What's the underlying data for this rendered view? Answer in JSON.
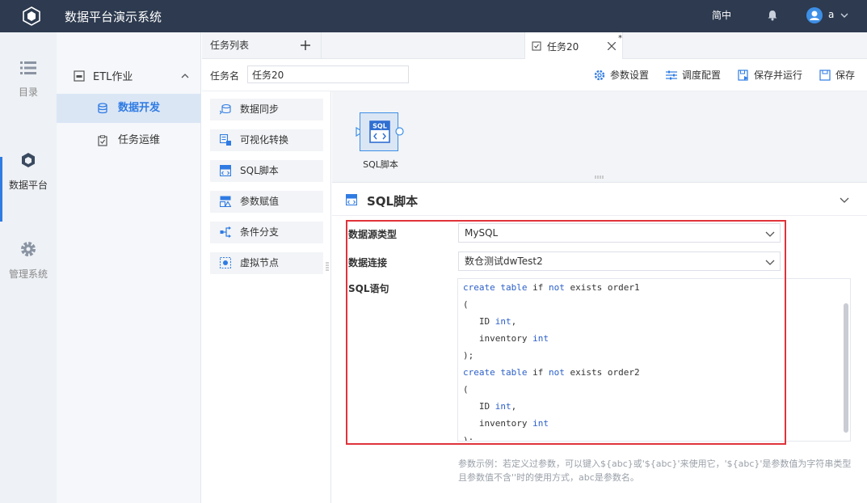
{
  "header": {
    "title": "数据平台演示系统",
    "language": "简中",
    "username": "a"
  },
  "rail": [
    {
      "label": "目录",
      "icon": "list-icon"
    },
    {
      "label": "数据平台",
      "icon": "cube-icon"
    },
    {
      "label": "管理系统",
      "icon": "gear-icon"
    }
  ],
  "nav": {
    "group": "ETL作业",
    "items": [
      {
        "label": "数据开发",
        "active": true
      },
      {
        "label": "任务运维",
        "active": false
      }
    ]
  },
  "tabs": {
    "list_label": "任务列表",
    "task_label": "任务20",
    "modified_mark": "*"
  },
  "toolbar": {
    "taskname_label": "任务名",
    "taskname_value": "任务20",
    "params": "参数设置",
    "schedule": "调度配置",
    "save_run": "保存并运行",
    "save": "保存"
  },
  "palette": [
    {
      "label": "数据同步",
      "icon": "sync-icon"
    },
    {
      "label": "可视化转换",
      "icon": "transform-icon"
    },
    {
      "label": "SQL脚本",
      "icon": "sql-icon"
    },
    {
      "label": "参数赋值",
      "icon": "param-assign-icon"
    },
    {
      "label": "条件分支",
      "icon": "branch-icon"
    },
    {
      "label": "虚拟节点",
      "icon": "virtual-node-icon"
    }
  ],
  "canvas": {
    "node_label": "SQL脚本",
    "node_badge": "SQL"
  },
  "panel": {
    "title": "SQL脚本",
    "datasource_type_label": "数据源类型",
    "datasource_type_value": "MySQL",
    "connection_label": "数据连接",
    "connection_value": "数仓测试dwTest2",
    "sql_label": "SQL语句",
    "sql_lines": [
      [
        {
          "t": "create table",
          "c": "kw"
        },
        {
          "t": " if ",
          "c": ""
        },
        {
          "t": "not",
          "c": "kw"
        },
        {
          "t": " exists order1",
          "c": ""
        }
      ],
      [
        {
          "t": "(",
          "c": ""
        }
      ],
      [
        {
          "t": "   ID ",
          "c": ""
        },
        {
          "t": "int",
          "c": "kw2"
        },
        {
          "t": ",",
          "c": ""
        }
      ],
      [
        {
          "t": "   inventory ",
          "c": ""
        },
        {
          "t": "int",
          "c": "kw2"
        }
      ],
      [
        {
          "t": ");",
          "c": ""
        }
      ],
      [
        {
          "t": "create table",
          "c": "kw"
        },
        {
          "t": " if ",
          "c": ""
        },
        {
          "t": "not",
          "c": "kw"
        },
        {
          "t": " exists order2",
          "c": ""
        }
      ],
      [
        {
          "t": "(",
          "c": ""
        }
      ],
      [
        {
          "t": "   ID ",
          "c": ""
        },
        {
          "t": "int",
          "c": "kw2"
        },
        {
          "t": ",",
          "c": ""
        }
      ],
      [
        {
          "t": "   inventory ",
          "c": ""
        },
        {
          "t": "int",
          "c": "kw2"
        }
      ],
      [
        {
          "t": ");",
          "c": ""
        }
      ]
    ],
    "hint": "参数示例：若定义过参数，可以键入${abc}或'${abc}'来使用它，'${abc}'是参数值为字符串类型且参数值不含''时的使用方式，abc是参数名。"
  },
  "colors": {
    "accent": "#2f7be3",
    "header_bg": "#2d3a4f",
    "highlight": "#e0333a"
  }
}
